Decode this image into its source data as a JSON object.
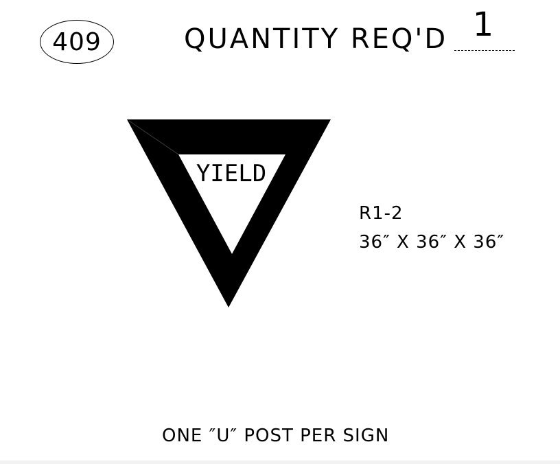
{
  "header": {
    "sign_number": "409",
    "quantity_label": "QUANTITY REQ'D",
    "quantity_value": "1"
  },
  "sign": {
    "legend": "YIELD",
    "code": "R1-2",
    "size": "36″ X 36″ X 36″",
    "shape": "inverted-triangle",
    "colors": {
      "border": "#000000",
      "field": "#ffffff"
    }
  },
  "footer": {
    "note": "ONE ″U″ POST PER SIGN"
  }
}
